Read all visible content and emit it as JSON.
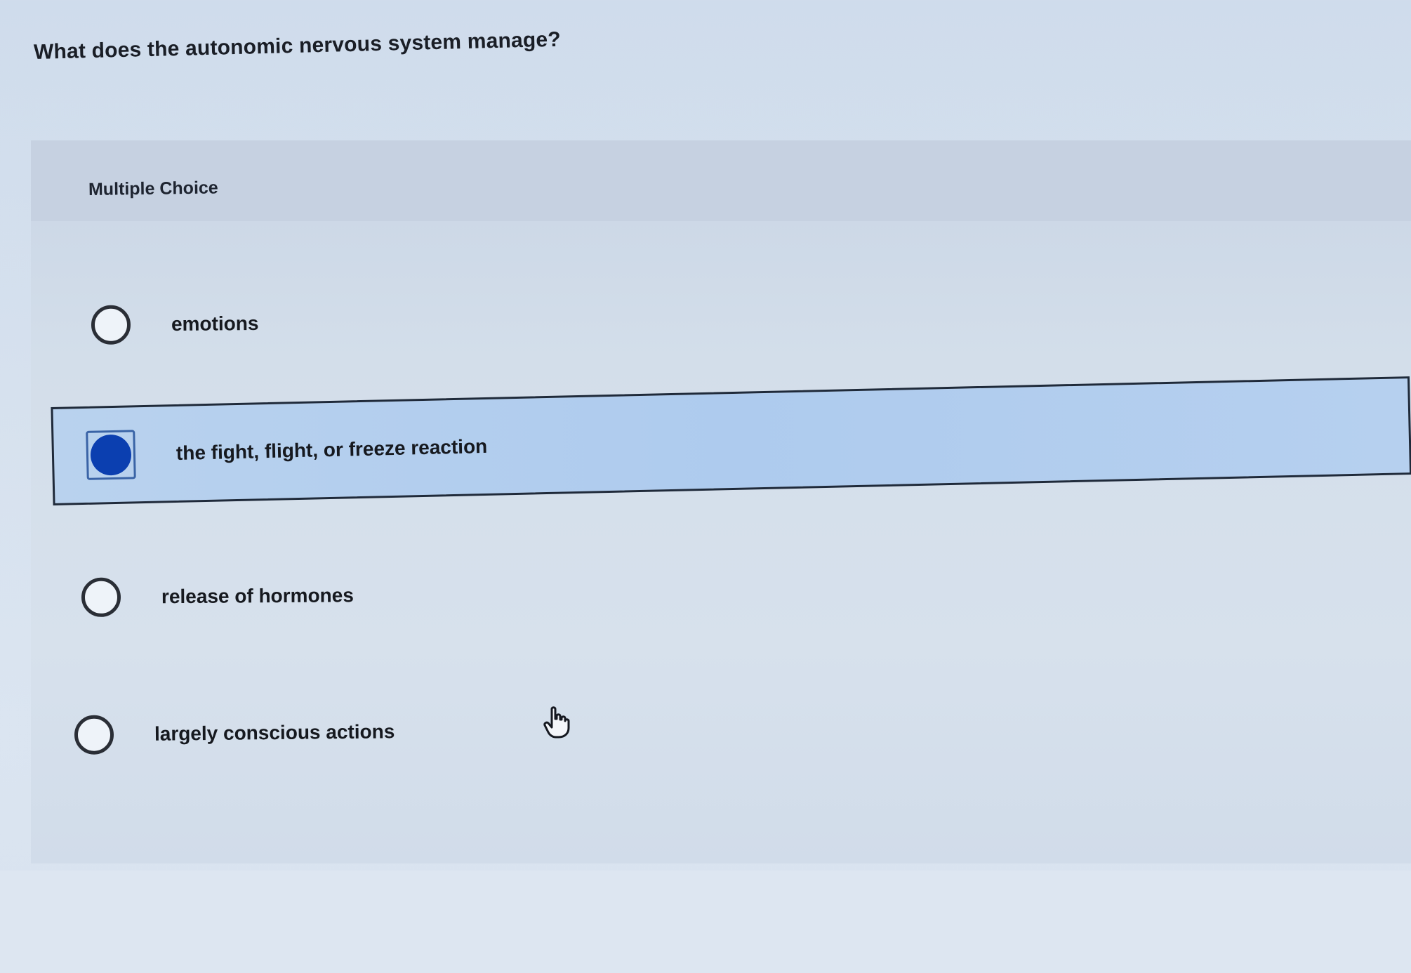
{
  "question": {
    "text": "What does the autonomic nervous system manage?"
  },
  "panel": {
    "type_label": "Multiple Choice"
  },
  "choices": [
    {
      "label": "emotions",
      "selected": false
    },
    {
      "label": "the fight, flight, or freeze reaction",
      "selected": true
    },
    {
      "label": "release of hormones",
      "selected": false
    },
    {
      "label": "largely conscious actions",
      "selected": false
    }
  ],
  "icons": {
    "cursor": "hand-pointer-icon"
  },
  "colors": {
    "selected_fill": "#0b3fb0",
    "selected_background": "#b3cdee",
    "selected_border": "#1f2a3a"
  }
}
